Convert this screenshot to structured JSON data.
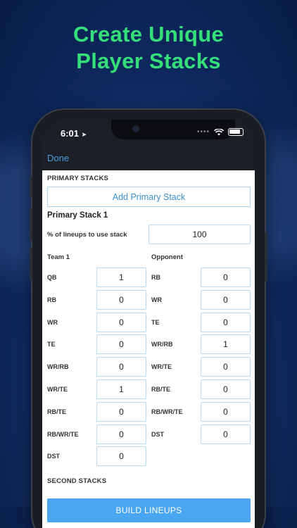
{
  "headline": {
    "line1": "Create Unique",
    "line2": "Player Stacks"
  },
  "status_bar": {
    "time": "6:01"
  },
  "nav": {
    "done_label": "Done"
  },
  "primary": {
    "section_title": "PRIMARY STACKS",
    "add_button_label": "Add Primary Stack",
    "stack_title": "Primary Stack 1",
    "pct_label": "% of lineups to use stack",
    "pct_value": "100",
    "team_header": "Team 1",
    "opponent_header": "Opponent",
    "team_rows": [
      {
        "label": "QB",
        "value": "1"
      },
      {
        "label": "RB",
        "value": "0"
      },
      {
        "label": "WR",
        "value": "0"
      },
      {
        "label": "TE",
        "value": "0"
      },
      {
        "label": "WR/RB",
        "value": "0"
      },
      {
        "label": "WR/TE",
        "value": "1"
      },
      {
        "label": "RB/TE",
        "value": "0"
      },
      {
        "label": "RB/WR/TE",
        "value": "0"
      },
      {
        "label": "DST",
        "value": "0"
      }
    ],
    "opponent_rows": [
      {
        "label": "RB",
        "value": "0"
      },
      {
        "label": "WR",
        "value": "0"
      },
      {
        "label": "TE",
        "value": "0"
      },
      {
        "label": "WR/RB",
        "value": "1"
      },
      {
        "label": "WR/TE",
        "value": "0"
      },
      {
        "label": "RB/TE",
        "value": "0"
      },
      {
        "label": "RB/WR/TE",
        "value": "0"
      },
      {
        "label": "DST",
        "value": "0"
      }
    ]
  },
  "second": {
    "section_title": "SECOND STACKS"
  },
  "build_button_label": "BUILD LINEUPS",
  "colors": {
    "accent_green": "#35e07a",
    "link_blue": "#3d8fd0",
    "build_blue": "#4aa6f0",
    "background_navy": "#0f2a63"
  }
}
